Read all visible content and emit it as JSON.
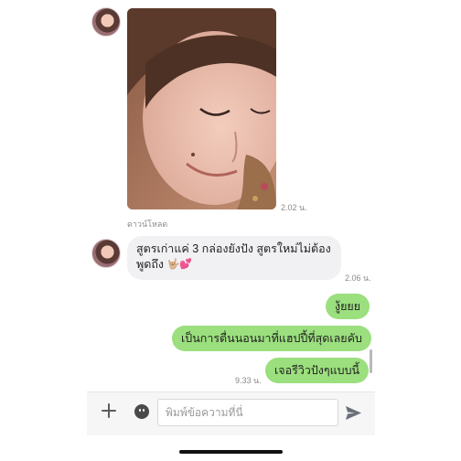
{
  "conversation": {
    "photo_message": {
      "time": "2.02 น.",
      "download_label": "ดาวน์โหลด"
    },
    "incoming_message": {
      "line1": "สูตรเก่าแค่ 3 กล่องยังปัง สูตรใหม่ไม่ต้อง",
      "line2": "พูดถึง",
      "emoji": "🤟🏼💕",
      "time": "2.06 น."
    },
    "outgoing_messages": [
      {
        "text": "งู้ยยย"
      },
      {
        "text": "เป็นการตื่นนอนมาที่แฮปปี้ที่สุดเลยคับ"
      },
      {
        "text": "เจอรีวิวปังๆแบบนี้"
      }
    ],
    "outgoing_time": "9.33 น."
  },
  "composer": {
    "placeholder": "พิมพ์ข้อความที่นี่",
    "value": "",
    "icons": {
      "add": "plus-icon",
      "emoji": "emoji-icon",
      "send": "send-icon"
    }
  },
  "colors": {
    "outgoing_bubble": "#9bdf7e",
    "incoming_bubble": "#f1f1f3",
    "timestamp": "#8a8a8a"
  }
}
